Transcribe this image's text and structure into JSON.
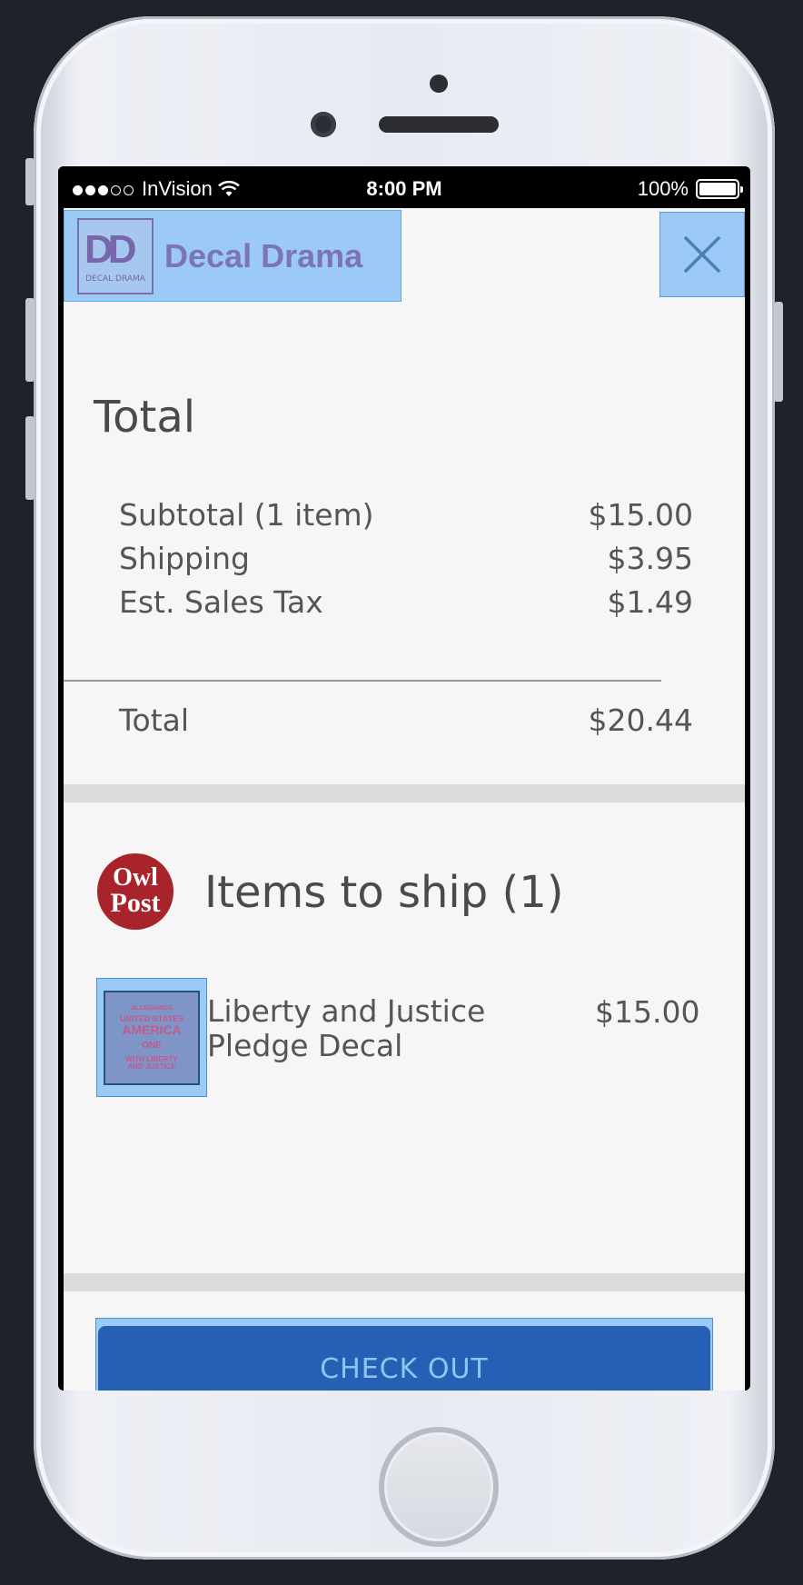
{
  "status_bar": {
    "carrier": "InVision",
    "time": "8:00 PM",
    "battery": "100%"
  },
  "header": {
    "brand_name": "Decal Drama",
    "logo_monogram": "DD",
    "logo_sub": "DECAL DRAMA"
  },
  "total_section": {
    "title": "Total",
    "rows": [
      {
        "label": "Subtotal (1 item)",
        "value": "$15.00"
      },
      {
        "label": "Shipping",
        "value": "$3.95"
      },
      {
        "label": "Est. Sales Tax",
        "value": "$1.49"
      }
    ],
    "total": {
      "label": "Total",
      "value": "$20.44"
    }
  },
  "items_section": {
    "logo_line1": "Owl",
    "logo_line2": "Post",
    "title": "Items to ship (1)",
    "items": [
      {
        "name": "Liberty and Justice Pledge Decal",
        "price": "$15.00",
        "thumb_text": [
          "ALLEGIANCE",
          "UNITED STATES",
          "AMERICA",
          "ONE",
          "WITH LIBERTY",
          "AND JUSTICE"
        ]
      }
    ]
  },
  "checkout": {
    "label": "CHECK OUT"
  },
  "colors": {
    "accent_highlight": "#9bcaf6",
    "checkout_button": "#2660b4",
    "owl_post_red": "#a8242a",
    "brand_purple": "#7c74b3"
  }
}
